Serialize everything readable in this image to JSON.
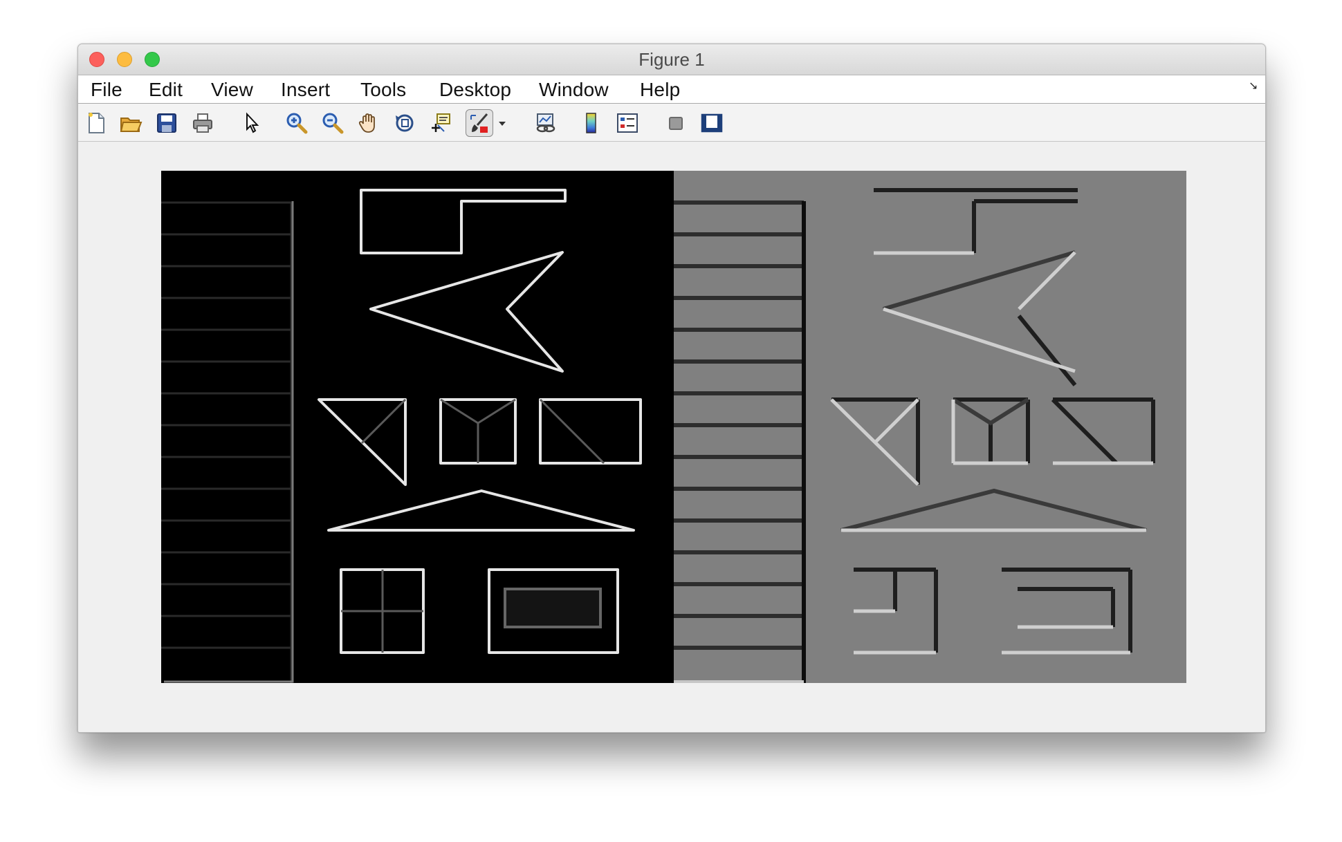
{
  "window": {
    "title": "Figure 1"
  },
  "menu": {
    "items": [
      "File",
      "Edit",
      "View",
      "Insert",
      "Tools",
      "Desktop",
      "Window",
      "Help"
    ]
  },
  "toolbar": {
    "buttons": [
      {
        "icon": "new-figure-icon"
      },
      {
        "icon": "open-file-icon"
      },
      {
        "icon": "save-icon"
      },
      {
        "icon": "print-icon"
      },
      {
        "icon": "pointer-icon"
      },
      {
        "icon": "zoom-in-icon"
      },
      {
        "icon": "zoom-out-icon"
      },
      {
        "icon": "pan-hand-icon"
      },
      {
        "icon": "rotate-3d-icon"
      },
      {
        "icon": "data-cursor-icon"
      },
      {
        "icon": "brush-icon",
        "active": true
      },
      {
        "icon": "link-plot-icon"
      },
      {
        "icon": "colorbar-icon"
      },
      {
        "icon": "legend-icon"
      },
      {
        "icon": "hide-plot-tools-icon"
      },
      {
        "icon": "show-plot-tools-icon"
      }
    ]
  },
  "colors": {
    "left_panel_bg": "#000000",
    "right_panel_bg": "#808080",
    "close": "#fc605c",
    "minimize": "#fdbc40",
    "maximize": "#34c84a"
  }
}
